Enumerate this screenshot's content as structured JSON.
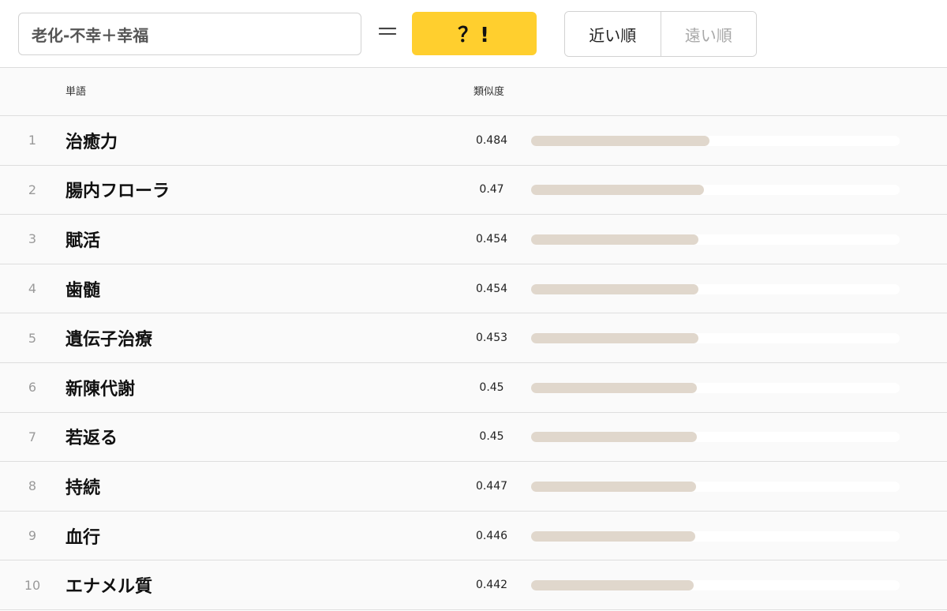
{
  "query": {
    "value": "老化-不幸＋幸福",
    "placeholder": ""
  },
  "equals_symbol": "＝",
  "solve_button": {
    "label": "？!"
  },
  "sort": {
    "options": [
      {
        "label": "近い順",
        "active": true
      },
      {
        "label": "遠い順",
        "active": false
      }
    ]
  },
  "table": {
    "headers": {
      "word": "単語",
      "similarity": "類似度"
    },
    "bar_scale_max": 1.0,
    "colors": {
      "bar_fill": "#e0d7cc",
      "bar_track": "#ffffff",
      "button_accent": "#ffcf2e"
    },
    "rows": [
      {
        "rank": "1",
        "word": "治癒力",
        "score": "0.484",
        "value": 0.484
      },
      {
        "rank": "2",
        "word": "腸内フローラ",
        "score": "0.47",
        "value": 0.47
      },
      {
        "rank": "3",
        "word": "賦活",
        "score": "0.454",
        "value": 0.454
      },
      {
        "rank": "4",
        "word": "歯髄",
        "score": "0.454",
        "value": 0.454
      },
      {
        "rank": "5",
        "word": "遺伝子治療",
        "score": "0.453",
        "value": 0.453
      },
      {
        "rank": "6",
        "word": "新陳代謝",
        "score": "0.45",
        "value": 0.45
      },
      {
        "rank": "7",
        "word": "若返る",
        "score": "0.45",
        "value": 0.45
      },
      {
        "rank": "8",
        "word": "持続",
        "score": "0.447",
        "value": 0.447
      },
      {
        "rank": "9",
        "word": "血行",
        "score": "0.446",
        "value": 0.446
      },
      {
        "rank": "10",
        "word": "エナメル質",
        "score": "0.442",
        "value": 0.442
      }
    ]
  }
}
